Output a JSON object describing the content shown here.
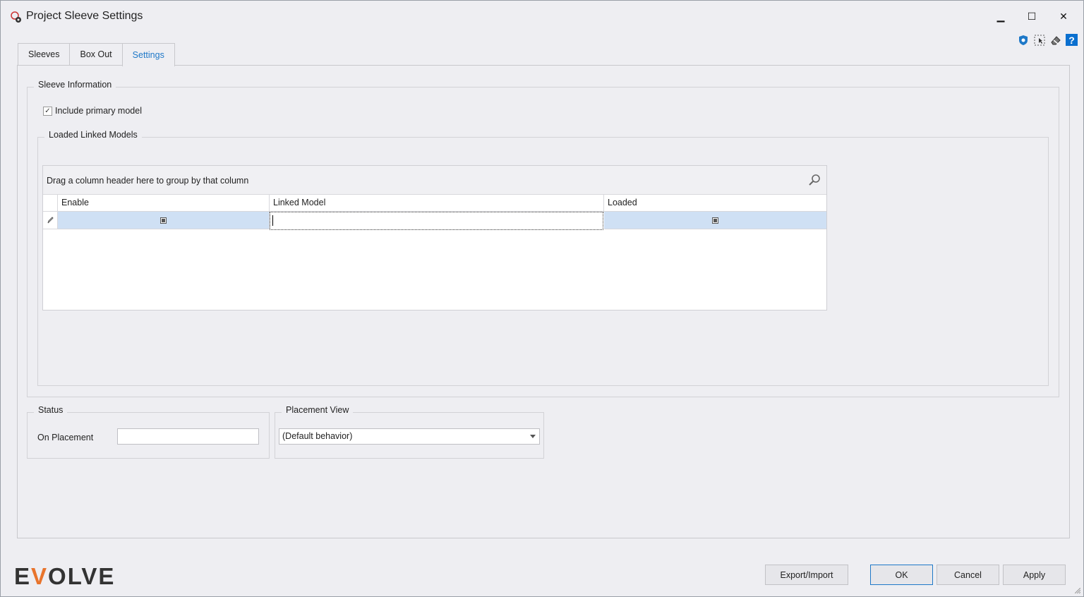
{
  "window": {
    "title": "Project Sleeve Settings",
    "minimize_glyph": "▁",
    "maximize_glyph": "☐",
    "close_glyph": "✕"
  },
  "toolbar_icons": [
    "shield-icon",
    "select-icon",
    "eraser-icon",
    "help-icon"
  ],
  "help_glyph": "?",
  "tabs": [
    {
      "label": "Sleeves",
      "active": false
    },
    {
      "label": "Box Out",
      "active": false
    },
    {
      "label": "Settings",
      "active": true
    }
  ],
  "sleeve_info": {
    "legend": "Sleeve Information",
    "include_primary_label": "Include primary model",
    "include_primary_checked": true,
    "check_glyph": "✓"
  },
  "linked_models": {
    "legend": "Loaded Linked Models",
    "group_panel_text": "Drag a column header here to group by that column",
    "columns": [
      "Enable",
      "Linked Model",
      "Loaded"
    ],
    "rows": [
      {
        "enable": "indeterminate",
        "linked_model": "",
        "loaded": "indeterminate"
      }
    ]
  },
  "status": {
    "legend": "Status",
    "on_placement_label": "On Placement",
    "on_placement_value": ""
  },
  "placement_view": {
    "legend": "Placement View",
    "selected": "(Default behavior)"
  },
  "footer": {
    "logo_parts": [
      "E",
      "V",
      "OLVE"
    ],
    "export_import": "Export/Import",
    "ok": "OK",
    "cancel": "Cancel",
    "apply": "Apply"
  },
  "colors": {
    "accent": "#1e78c8",
    "logo_v": "#e8742c",
    "selected_row": "#cfe0f4"
  }
}
